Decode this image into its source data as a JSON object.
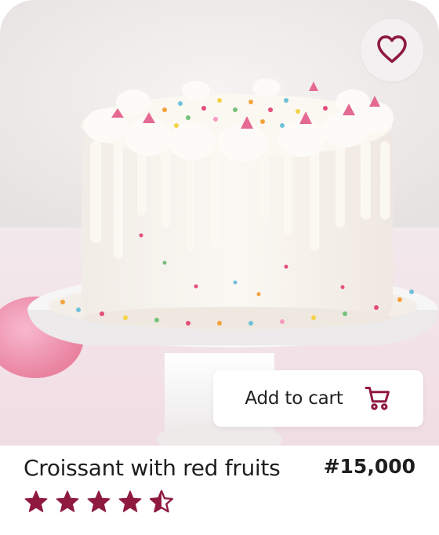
{
  "product": {
    "name": "Croissant with red fruits",
    "price": "#15,000",
    "rating": 4.5,
    "rating_max": 5
  },
  "actions": {
    "add_to_cart_label": "Add to cart"
  },
  "icons": {
    "favorite": "heart-outline-icon",
    "cart": "shopping-cart-icon",
    "rating": "star-icon"
  },
  "colors": {
    "accent": "#8f1a3f",
    "text": "#1e1e1e",
    "button_bg": "#ffffff",
    "fav_bg": "#f3f0f1"
  }
}
